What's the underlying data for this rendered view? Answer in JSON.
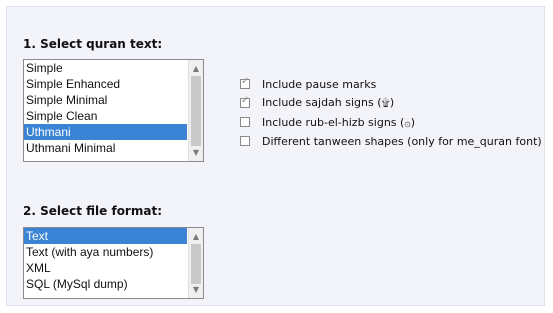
{
  "section_quran_text": {
    "heading": "1. Select quran text:",
    "options": [
      {
        "label": "Simple",
        "selected": false
      },
      {
        "label": "Simple Enhanced",
        "selected": false
      },
      {
        "label": "Simple Minimal",
        "selected": false
      },
      {
        "label": "Simple Clean",
        "selected": false
      },
      {
        "label": "Uthmani",
        "selected": true
      },
      {
        "label": "Uthmani Minimal",
        "selected": false
      }
    ]
  },
  "checkboxes": [
    {
      "label": "Include pause marks",
      "checked": true
    },
    {
      "label": "Include sajdah signs (۩)",
      "checked": true
    },
    {
      "label": "Include rub-el-hizb signs (۞)",
      "checked": false
    },
    {
      "label": "Different tanween shapes (only for me_quran font)",
      "checked": false
    }
  ],
  "section_file_format": {
    "heading": "2. Select file format:",
    "options": [
      {
        "label": "Text",
        "selected": true
      },
      {
        "label": "Text (with aya numbers)",
        "selected": false
      },
      {
        "label": "XML",
        "selected": false
      },
      {
        "label": "SQL (MySql dump)",
        "selected": false
      }
    ]
  },
  "icons": {
    "scroll_up": "chevron-up-icon",
    "scroll_down": "chevron-down-icon"
  },
  "colors": {
    "selection": "#3a83d5",
    "panel_background": "#f3f3fa"
  }
}
